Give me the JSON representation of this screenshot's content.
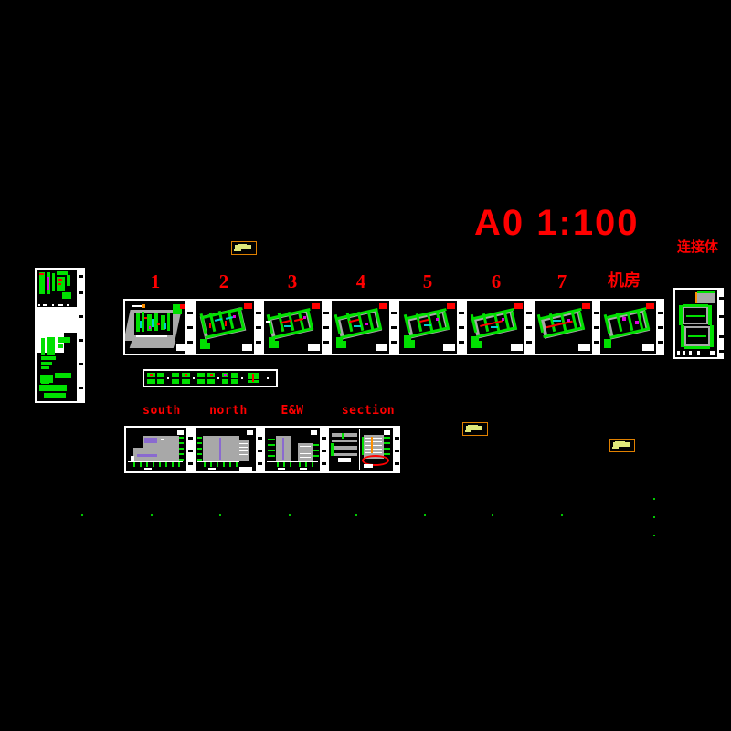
{
  "document": {
    "type": "cad-drawing-sheet",
    "background_color": "#000000",
    "title": "A0  1:100",
    "title_color": "#ff0000"
  },
  "titleblock": {
    "sheet_size_scale": "A0  1:100"
  },
  "plan_panels": {
    "label_color": "#ff0000",
    "items": [
      {
        "label": "1",
        "name": "site-plan"
      },
      {
        "label": "2",
        "name": "floor-plan-2"
      },
      {
        "label": "3",
        "name": "floor-plan-3"
      },
      {
        "label": "4",
        "name": "floor-plan-4"
      },
      {
        "label": "5",
        "name": "floor-plan-5"
      },
      {
        "label": "6",
        "name": "floor-plan-6"
      },
      {
        "label": "7",
        "name": "floor-plan-7"
      },
      {
        "label": "机房",
        "name": "machine-room-plan"
      }
    ]
  },
  "side_panel": {
    "label": "连接体",
    "label_color": "#ff0000"
  },
  "elevation_panels": {
    "label_color": "#ff0000",
    "items": [
      {
        "label": "south",
        "name": "south-elevation"
      },
      {
        "label": "north",
        "name": "north-elevation"
      },
      {
        "label": "E&W",
        "name": "east-west-elevation"
      },
      {
        "label": "section",
        "name": "building-section"
      }
    ]
  },
  "index_sheet": {
    "name": "drawing-index-sheet"
  },
  "detail_strip": {
    "count": 5
  },
  "note_markers": {
    "count": 3,
    "border_color": "#e08000",
    "fill_color": "#dfe87a"
  },
  "colors": {
    "background": "#000000",
    "annotation_green": "#00e000",
    "building_gray": "#a8a8a8",
    "accent_red": "#ff0000",
    "accent_cyan": "#00d0d0",
    "accent_magenta": "#e000e0",
    "accent_violet": "#8a6ad0",
    "frame_white": "#ffffff"
  }
}
